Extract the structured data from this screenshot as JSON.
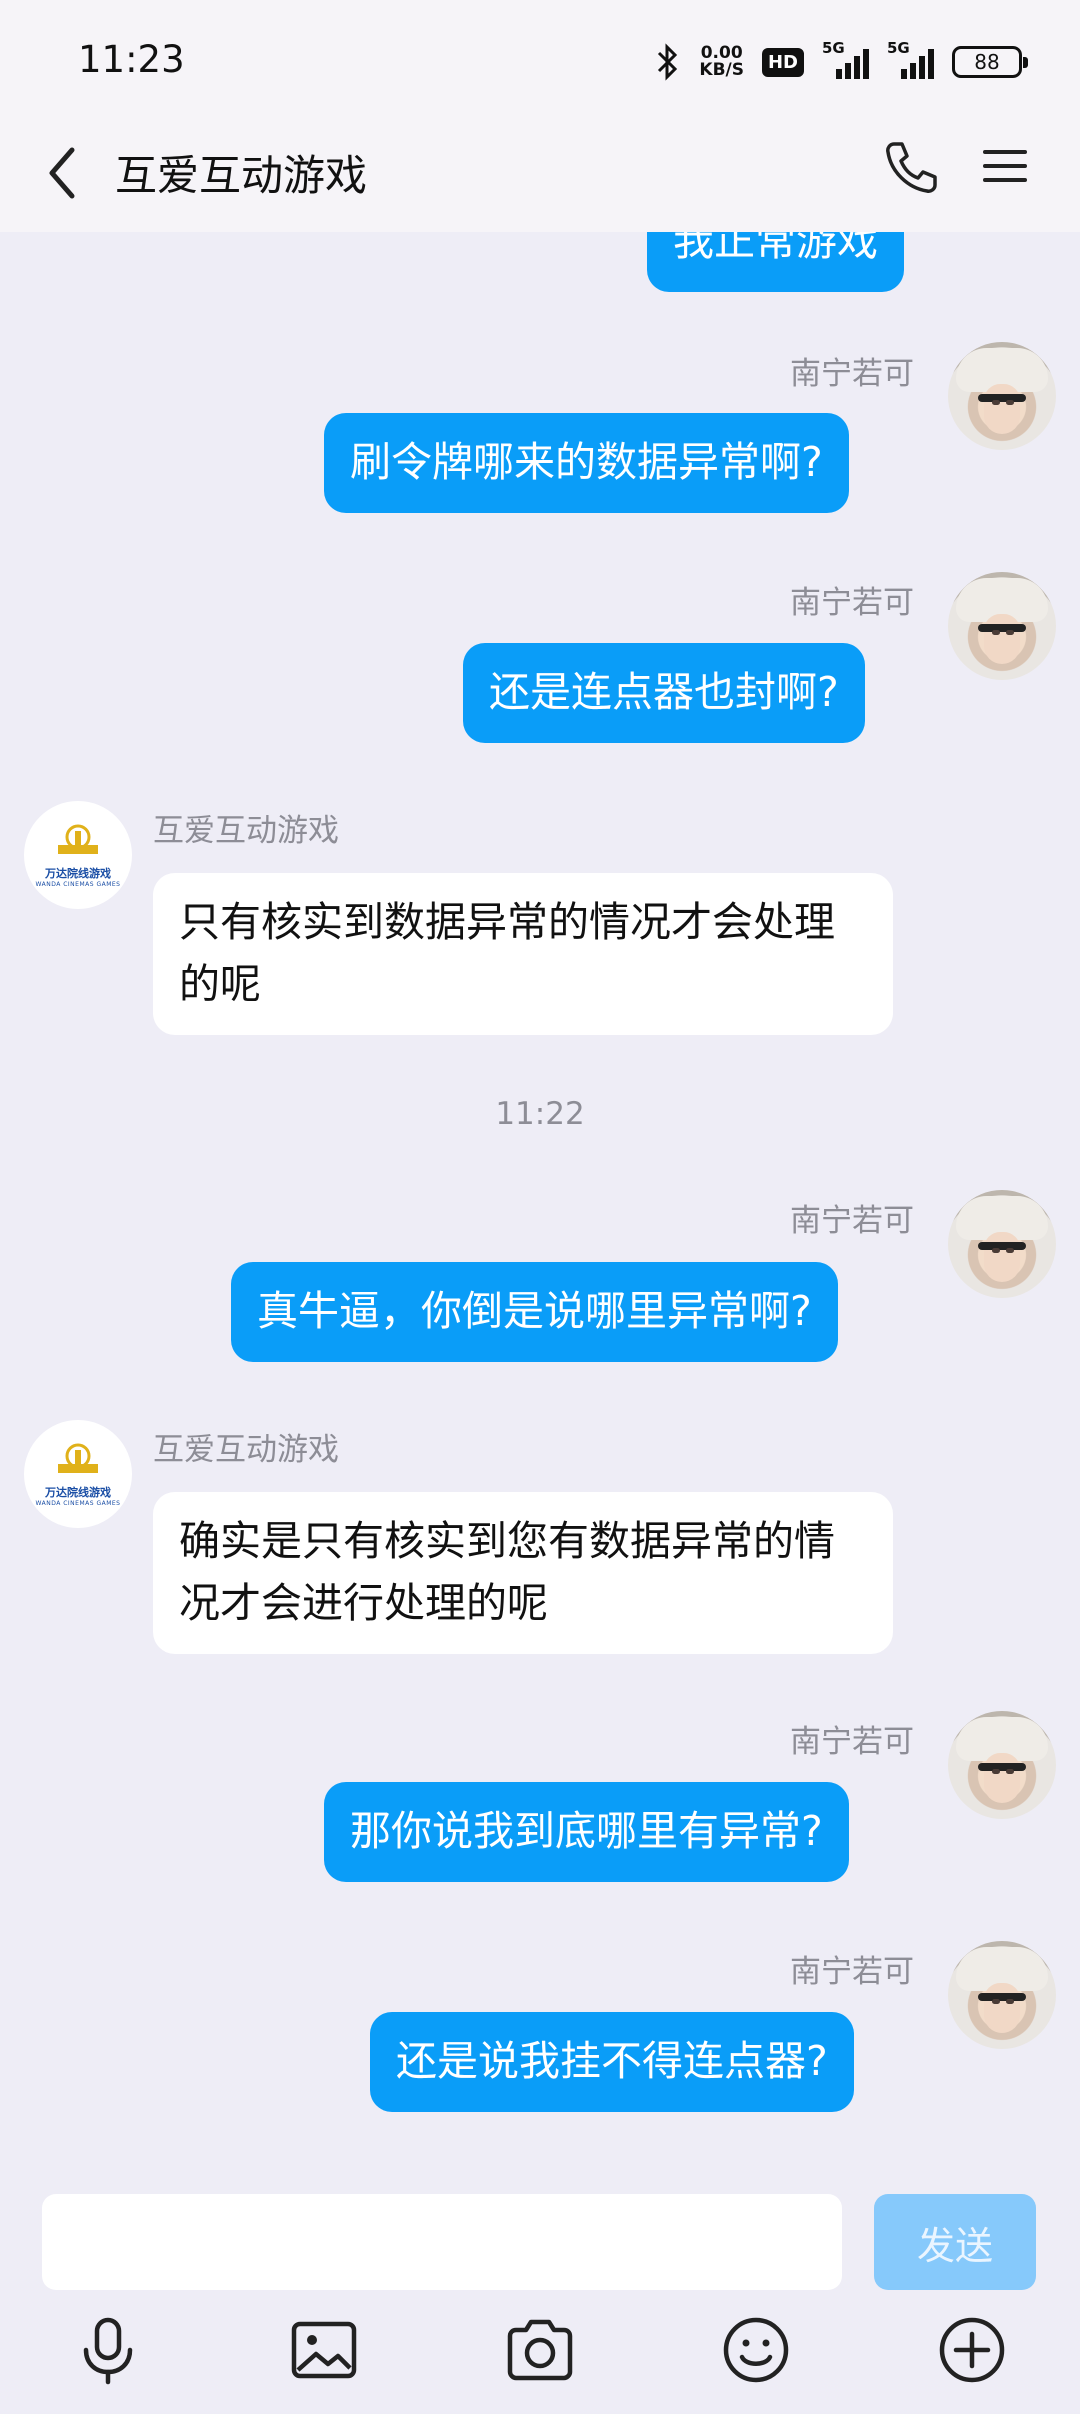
{
  "status_bar": {
    "time": "11:23",
    "speed_value": "0.00",
    "speed_unit": "KB/S",
    "hd_label": "HD",
    "sim1_label": "5G",
    "sim2_label": "5G",
    "battery": "88"
  },
  "header": {
    "title": "互爱互动游戏"
  },
  "messages": [
    {
      "side": "out",
      "text": "我正常游戏"
    },
    {
      "side": "out",
      "sender": "南宁若可",
      "text": "刷令牌哪来的数据异常啊?"
    },
    {
      "side": "out",
      "sender": "南宁若可",
      "text": "还是连点器也封啊?"
    },
    {
      "side": "in",
      "sender": "互爱互动游戏",
      "text": "只有核实到数据异常的情况才会处理的呢"
    },
    {
      "side": "time",
      "text": "11:22"
    },
    {
      "side": "out",
      "sender": "南宁若可",
      "text": "真牛逼，你倒是说哪里异常啊?"
    },
    {
      "side": "in",
      "sender": "互爱互动游戏",
      "text": "确实是只有核实到您有数据异常的情况才会进行处理的呢"
    },
    {
      "side": "out",
      "sender": "南宁若可",
      "text": "那你说我到底哪里有异常?"
    },
    {
      "side": "out",
      "sender": "南宁若可",
      "text": "还是说我挂不得连点器?"
    }
  ],
  "company_avatar": {
    "name": "万达院线游戏",
    "sub": "WANDA CINEMAS GAMES"
  },
  "input": {
    "value": "",
    "send_label": "发送"
  },
  "toolbar": {
    "icons": [
      "microphone-icon",
      "image-icon",
      "camera-icon",
      "emoji-icon",
      "plus-icon"
    ]
  },
  "colors": {
    "outgoing_bubble": "#0a9df8",
    "incoming_bubble": "#ffffff",
    "background": "#eeedf6",
    "send_disabled": "#86c9fb"
  }
}
